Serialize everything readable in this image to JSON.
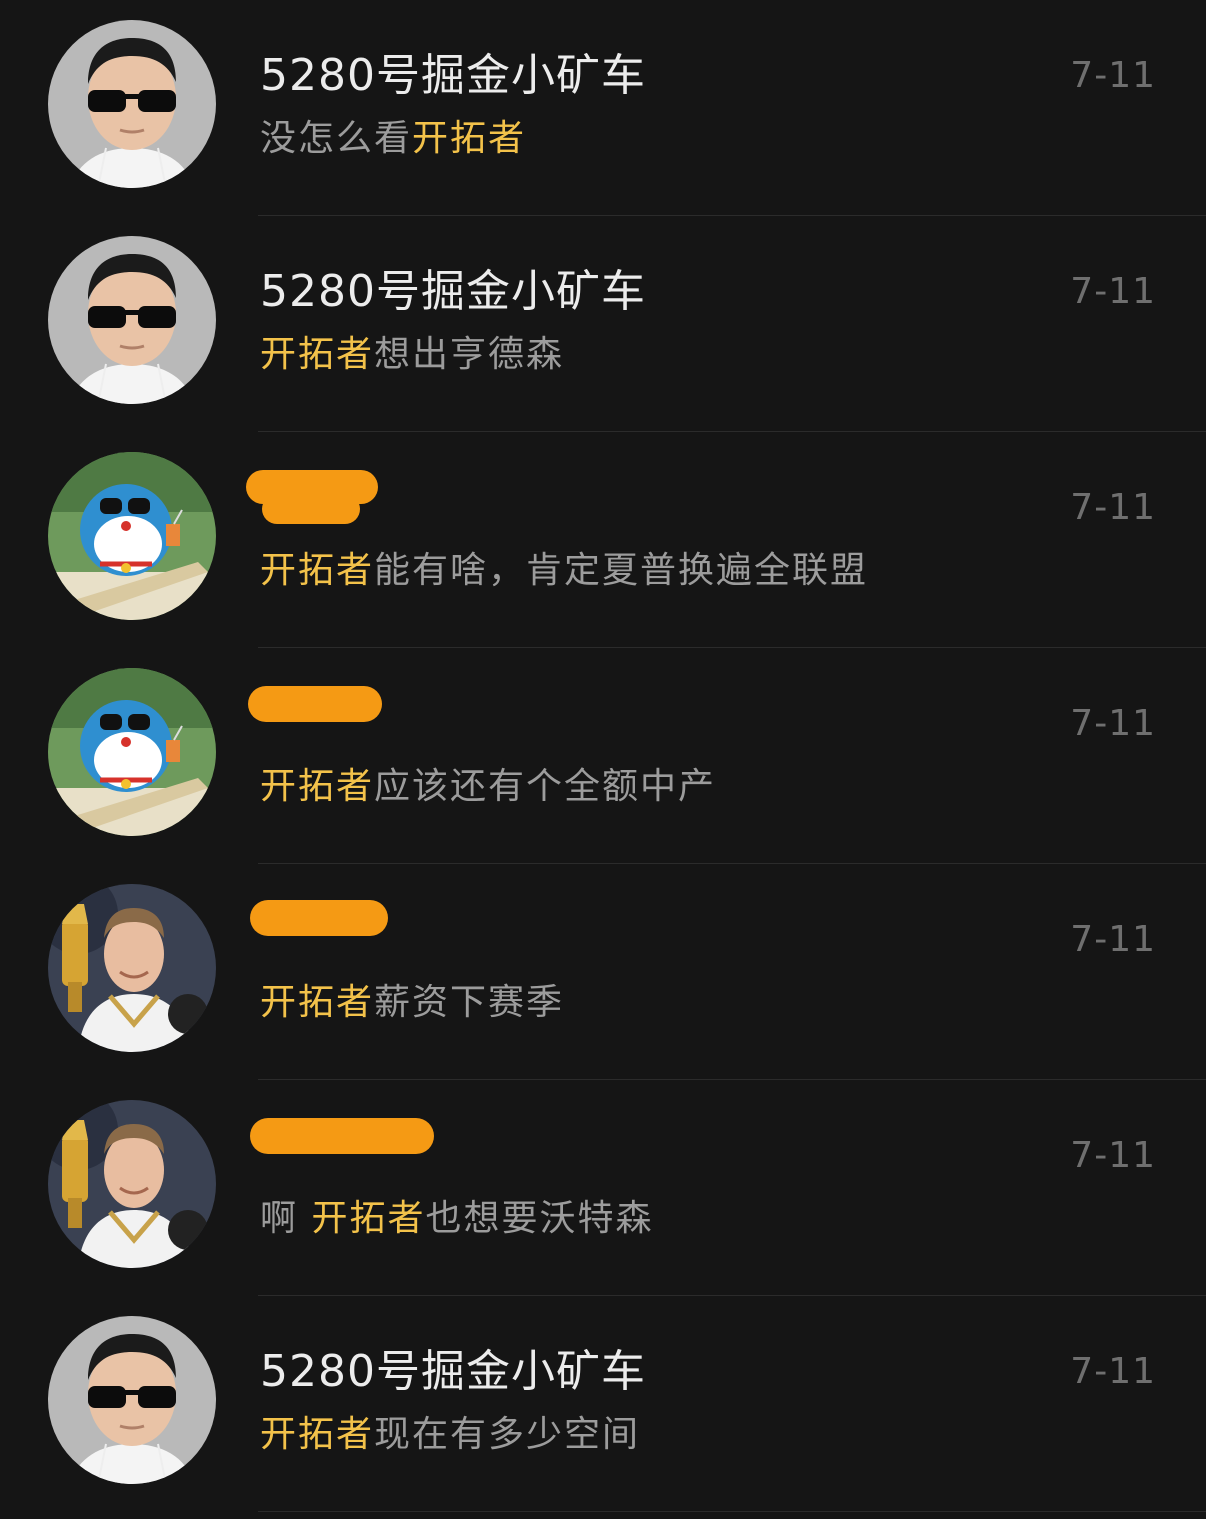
{
  "colors": {
    "background": "#151515",
    "name_text": "#ececec",
    "message_text": "#9c9c9c",
    "keyword": "#f3c24a",
    "time_text": "#6f6f6f",
    "redaction": "#f59a14"
  },
  "rows": [
    {
      "avatar": "man-sunglasses",
      "name": "5280号掘金小矿车",
      "name_redacted": false,
      "time": "7-11",
      "msg_before": "没怎么看",
      "msg_keyword": "开拓者",
      "msg_after": ""
    },
    {
      "avatar": "man-sunglasses",
      "name": "5280号掘金小矿车",
      "name_redacted": false,
      "time": "7-11",
      "msg_before": "",
      "msg_keyword": "开拓者",
      "msg_after": "想出亨德森"
    },
    {
      "avatar": "doraemon-beach",
      "name": "",
      "name_redacted": true,
      "time": "7-11",
      "msg_before": "",
      "msg_keyword": "开拓者",
      "msg_after": "能有啥，肯定夏普换遍全联盟"
    },
    {
      "avatar": "doraemon-beach",
      "name": "",
      "name_redacted": true,
      "time": "7-11",
      "msg_before": "",
      "msg_keyword": "开拓者",
      "msg_after": "应该还有个全额中产"
    },
    {
      "avatar": "basketball-player",
      "name": "",
      "name_redacted": true,
      "time": "7-11",
      "msg_before": "",
      "msg_keyword": "开拓者",
      "msg_after": "薪资下赛季"
    },
    {
      "avatar": "basketball-player",
      "name": "",
      "name_redacted": true,
      "time": "7-11",
      "msg_before": "啊 ",
      "msg_keyword": "开拓者",
      "msg_after": "也想要沃特森"
    },
    {
      "avatar": "man-sunglasses",
      "name": "5280号掘金小矿车",
      "name_redacted": false,
      "time": "7-11",
      "msg_before": "",
      "msg_keyword": "开拓者",
      "msg_after": "现在有多少空间"
    }
  ]
}
